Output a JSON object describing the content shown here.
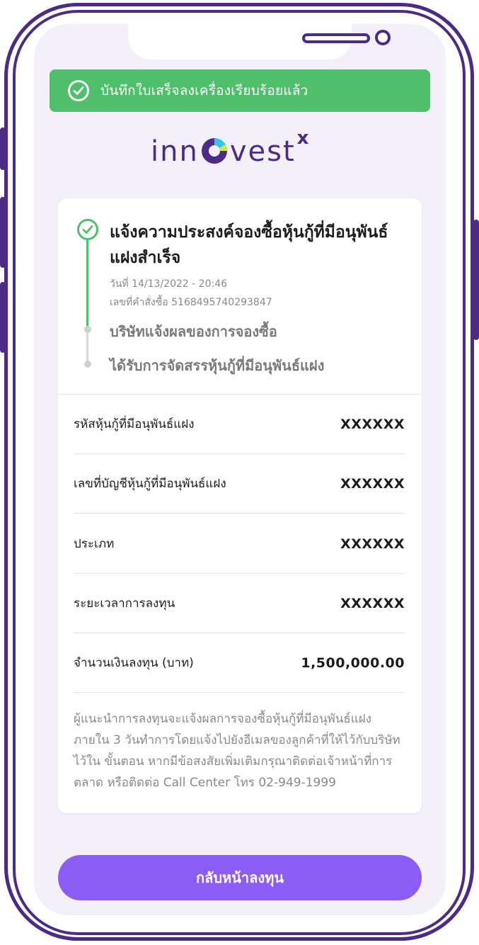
{
  "toast": {
    "message": "บันทึกใบเสร็จลงเครื่องเรียบร้อยแล้ว"
  },
  "logo": {
    "prefix": "inn",
    "suffix": "vest",
    "sup": "x"
  },
  "status": {
    "title": "แจ้งความประสงค์จองซื้อหุ้นกู้ที่มีอนุพันธ์แฝงสำเร็จ",
    "date": "วันที่ 14/13/2022 - 20:46",
    "order_no": "เลขที่คำสั่งซื้อ 5168495740293847",
    "step2": "บริษัทแจ้งผลของการจองซื้อ",
    "step3": "ได้รับการจัดสรรหุ้นกู้ที่มีอนุพันธ์แฝง"
  },
  "details": [
    {
      "label": "รหัสหุ้นกู้ที่มีอนุพันธ์แฝง",
      "value": "XXXXXX"
    },
    {
      "label": "เลขที่บัญชีหุ้นกู้ที่มีอนุพันธ์แฝง",
      "value": "XXXXXX"
    },
    {
      "label": "ประเภท",
      "value": "XXXXXX"
    },
    {
      "label": "ระยะเวลาการลงทุน",
      "value": "XXXXXX"
    },
    {
      "label": "จำนวนเงินลงทุน (บาท)",
      "value": "1,500,000.00"
    }
  ],
  "note": "ผู้แนะนำการลงทุนจะแจ้งผลการจองซื้อหุ้นกู้ที่มีอนุพันธ์แฝง ภายใน 3 วันทำการโดยแจ้งไปยังอีเมลของลูกค้าที่ให้ไว้กับบริษัท ไว้ใน ขั้นตอน หากมีข้อสงสัยเพิ่มเติมกรุณาติดต่อเจ้าหน้าที่การตลาด หรือติดต่อ Call Center โทร 02-949-1999",
  "cta": {
    "label": "กลับหน้าลงทุน"
  },
  "colors": {
    "brand": "#4b2b86",
    "success": "#4fbf6b",
    "cta": "#8b5cf6",
    "background": "#f3f0fa"
  }
}
